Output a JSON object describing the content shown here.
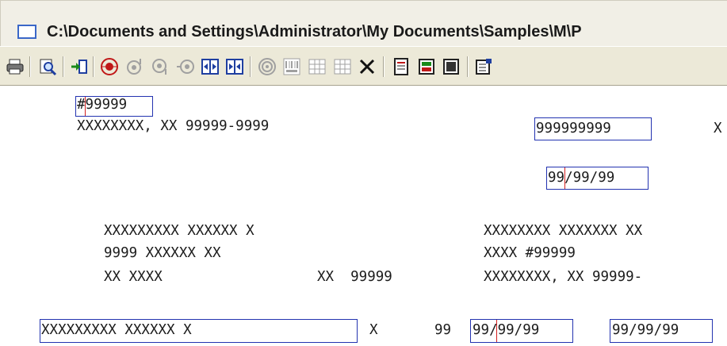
{
  "window": {
    "title": "C:\\Documents and Settings\\Administrator\\My Documents\\Samples\\M\\P"
  },
  "toolbar": {
    "buttons": [
      {
        "name": "print-icon",
        "glyph": "🖶"
      },
      {
        "name": "print-preview-icon",
        "glyph": "🔍"
      },
      {
        "name": "insert-field-icon",
        "glyph": "→"
      },
      {
        "name": "target-icon",
        "glyph": "◉"
      },
      {
        "name": "move-up-icon",
        "glyph": "◎"
      },
      {
        "name": "move-down-icon",
        "glyph": "◎"
      },
      {
        "name": "move-left-icon",
        "glyph": "◎"
      },
      {
        "name": "expand-icon",
        "glyph": "⊞"
      },
      {
        "name": "collapse-icon",
        "glyph": "⊟"
      },
      {
        "name": "radar-icon",
        "glyph": "◎"
      },
      {
        "name": "barcode-icon",
        "glyph": "▦"
      },
      {
        "name": "grid-icon",
        "glyph": "▤"
      },
      {
        "name": "grid2-icon",
        "glyph": "▤"
      },
      {
        "name": "delete-icon",
        "glyph": "✕"
      },
      {
        "name": "doc-icon",
        "glyph": "▣"
      },
      {
        "name": "form-icon",
        "glyph": "▣"
      },
      {
        "name": "panel-icon",
        "glyph": "▣"
      },
      {
        "name": "properties-icon",
        "glyph": "☰"
      }
    ]
  },
  "canvas": {
    "line1_field": "#99999",
    "line2_left": "XXXXXXXX, XX 99999-9999",
    "line2_field": "999999999",
    "line2_right": "X",
    "date_field_1": "99/99/99",
    "addr_left_1": "XXXXXXXXX XXXXXX X",
    "addr_left_2": "9999 XXXXXX XX",
    "addr_left_3a": "XX XXXX",
    "addr_left_3b": "XX  99999",
    "addr_right_1": "XXXXXXXX XXXXXXX XX",
    "addr_right_2": "XXXX #99999",
    "addr_right_3": "XXXXXXXX, XX 99999-",
    "bottom_field": "XXXXXXXXX XXXXXX X",
    "bottom_x": "X",
    "bottom_99": "99",
    "bottom_date_1": "99/99/99",
    "bottom_date_2": "99/99/99"
  },
  "colors": {
    "field_border": "#2333b0",
    "marker_red": "#d42020",
    "toolbar_bg": "#ece9d8",
    "title_bg": "#f1efe6"
  }
}
